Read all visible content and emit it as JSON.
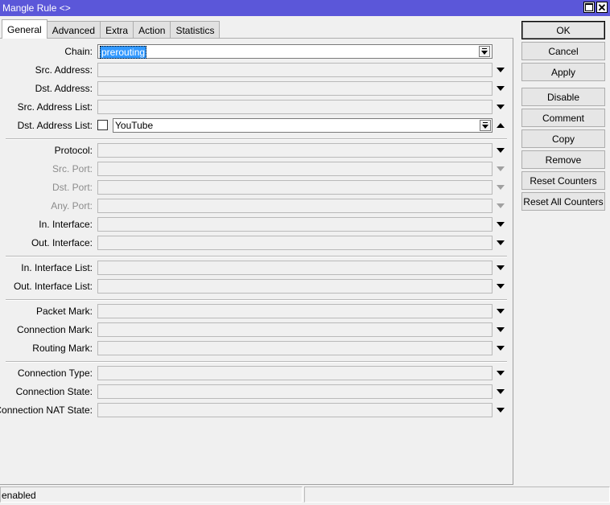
{
  "window": {
    "title": "Mangle Rule <>",
    "maximize_icon": "maximize-icon",
    "close_label": "✕"
  },
  "tabs": [
    {
      "label": "General",
      "active": true
    },
    {
      "label": "Advanced",
      "active": false
    },
    {
      "label": "Extra",
      "active": false
    },
    {
      "label": "Action",
      "active": false
    },
    {
      "label": "Statistics",
      "active": false
    }
  ],
  "form": {
    "chain": {
      "label": "Chain:",
      "value": "prerouting"
    },
    "src_address": {
      "label": "Src. Address:",
      "value": ""
    },
    "dst_address": {
      "label": "Dst. Address:",
      "value": ""
    },
    "src_address_list": {
      "label": "Src. Address List:",
      "value": ""
    },
    "dst_address_list": {
      "label": "Dst. Address List:",
      "value": "YouTube",
      "negated": false
    },
    "protocol": {
      "label": "Protocol:",
      "value": ""
    },
    "src_port": {
      "label": "Src. Port:",
      "value": ""
    },
    "dst_port": {
      "label": "Dst. Port:",
      "value": ""
    },
    "any_port": {
      "label": "Any. Port:",
      "value": ""
    },
    "in_interface": {
      "label": "In. Interface:",
      "value": ""
    },
    "out_interface": {
      "label": "Out. Interface:",
      "value": ""
    },
    "in_interface_list": {
      "label": "In. Interface List:",
      "value": ""
    },
    "out_interface_list": {
      "label": "Out. Interface List:",
      "value": ""
    },
    "packet_mark": {
      "label": "Packet Mark:",
      "value": ""
    },
    "connection_mark": {
      "label": "Connection Mark:",
      "value": ""
    },
    "routing_mark": {
      "label": "Routing Mark:",
      "value": ""
    },
    "connection_type": {
      "label": "Connection Type:",
      "value": ""
    },
    "connection_state": {
      "label": "Connection State:",
      "value": ""
    },
    "connection_nat_state": {
      "label": "Connection NAT State:",
      "value": ""
    }
  },
  "buttons": {
    "ok": "OK",
    "cancel": "Cancel",
    "apply": "Apply",
    "disable": "Disable",
    "comment": "Comment",
    "copy": "Copy",
    "remove": "Remove",
    "reset_counters": "Reset Counters",
    "reset_all_counters": "Reset All Counters"
  },
  "status": {
    "left": "enabled",
    "right": ""
  }
}
